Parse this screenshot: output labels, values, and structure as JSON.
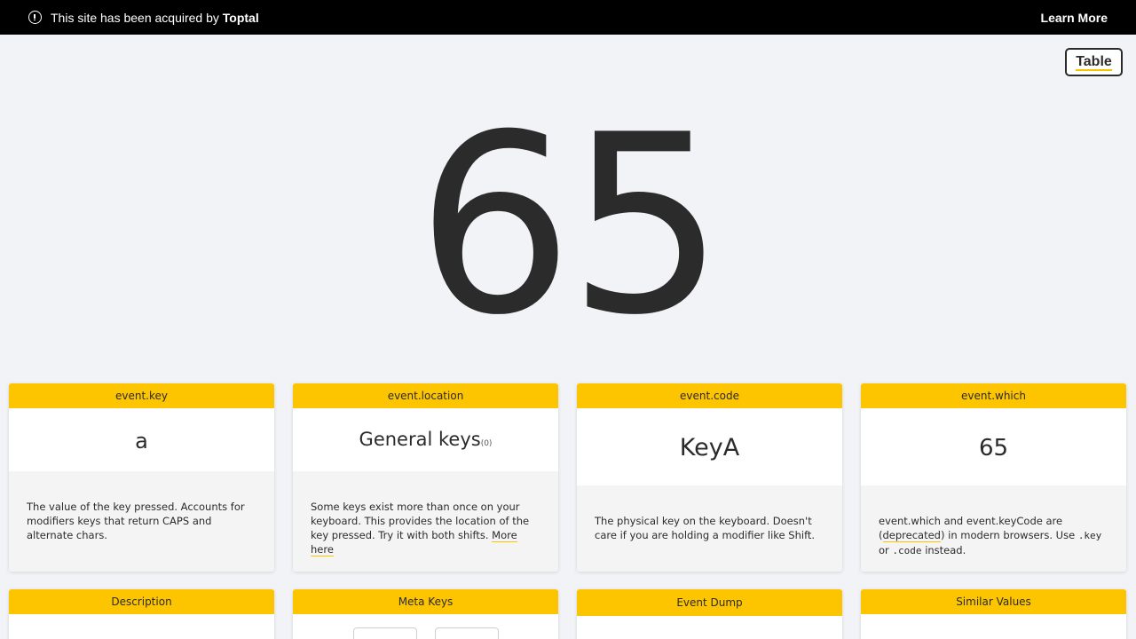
{
  "banner": {
    "message": "This site has been acquired by",
    "brand": "Toptal",
    "learn_more": "Learn More"
  },
  "table_button": "Table",
  "key_code": "65",
  "cards": {
    "key": {
      "title": "event.key",
      "value": "a",
      "desc": "The value of the key pressed. Accounts for modifiers keys that return CAPS and alternate chars."
    },
    "location": {
      "title": "event.location",
      "value": "General keys",
      "sub": "(0)",
      "desc": "Some keys exist more than once on your keyboard. This provides the location of the key pressed. Try it with both shifts.",
      "link": "More here"
    },
    "code": {
      "title": "event.code",
      "value": "KeyA",
      "desc": "The physical key on the keyboard. Doesn't care if you are holding a modifier like Shift."
    },
    "which": {
      "title": "event.which",
      "value": "65",
      "desc_1": "event.which and event.keyCode are (",
      "link": "deprecated",
      "desc_2": ") in modern browsers. Use",
      "code_key": ".key",
      "or": "or",
      "code_code": ".code",
      "desc_3": "instead."
    }
  },
  "lower_cards": {
    "description": "Description",
    "meta_keys": "Meta Keys",
    "event_dump": "Event Dump",
    "similar_values": "Similar Values"
  },
  "colors": {
    "accent": "#fdc500",
    "banner_bg": "#000000",
    "page_bg": "#f2f3f7"
  }
}
